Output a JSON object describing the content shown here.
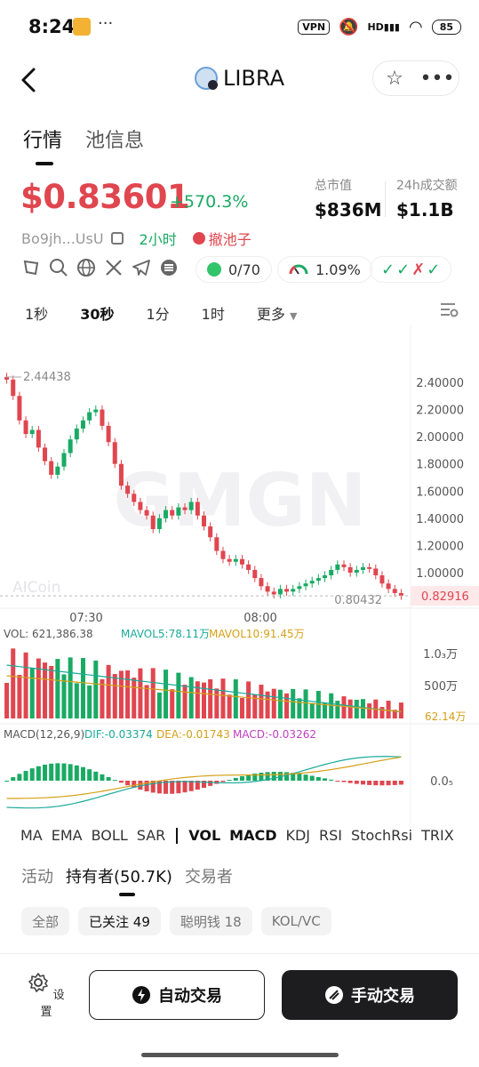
{
  "status": {
    "time": "8:24",
    "vpn": "VPN",
    "hd": "HD",
    "battery": "85"
  },
  "header": {
    "title": "LIBRA"
  },
  "top_tabs": [
    {
      "label": "行情"
    },
    {
      "label": "池信息"
    }
  ],
  "price": {
    "value": "$0.83601",
    "change": "+570.3%"
  },
  "stats": [
    {
      "label": "总市值",
      "value": "$836M"
    },
    {
      "label": "24h成交额",
      "value": "$1.1B"
    }
  ],
  "meta": {
    "address": "Bo9jh...UsU",
    "age": "2小时",
    "pool": "撤池子"
  },
  "chips": {
    "holders_ratio": "0/70",
    "percent": "1.09%"
  },
  "timeframes": [
    "1秒",
    "30秒",
    "1分",
    "1时",
    "更多"
  ],
  "chart_data": {
    "type": "candlestick",
    "price_axis": {
      "ticks": [
        "2.40000",
        "2.20000",
        "2.00000",
        "1.80000",
        "1.60000",
        "1.40000",
        "1.20000",
        "1.00000"
      ],
      "high_label": "2.44438",
      "low_label": "0.80432",
      "current_label": "0.82916"
    },
    "time_ticks": [
      "07:30",
      "08:00"
    ],
    "watermark": "GMGN",
    "source_watermark": "AICoin",
    "close_series": [
      2.42,
      2.3,
      2.12,
      2.02,
      2.05,
      1.92,
      1.82,
      1.72,
      1.78,
      1.88,
      1.98,
      2.06,
      2.12,
      2.18,
      2.2,
      2.08,
      1.96,
      1.8,
      1.64,
      1.58,
      1.52,
      1.46,
      1.42,
      1.32,
      1.4,
      1.46,
      1.42,
      1.48,
      1.46,
      1.52,
      1.42,
      1.34,
      1.26,
      1.16,
      1.1,
      1.08,
      1.1,
      1.06,
      1.02,
      0.96,
      0.9,
      0.86,
      0.84,
      0.88,
      0.86,
      0.88,
      0.9,
      0.92,
      0.94,
      0.96,
      0.98,
      1.02,
      1.06,
      1.04,
      1.0,
      1.02,
      1.04,
      1.03,
      0.98,
      0.92,
      0.88,
      0.85,
      0.83
    ]
  },
  "volume": {
    "label": "VOL: 621,386.38",
    "ma5": "MAVOL5:78.11万",
    "ma10": "MAVOL10:91.45万",
    "ticks": [
      "1.0₃万",
      "500万"
    ],
    "current": "62.14万"
  },
  "macd": {
    "label": "MACD(12,26,9)",
    "dif": "DIF:-0.03374",
    "dea": "DEA:-0.01743",
    "macd": "MACD:-0.03262",
    "tick": "0.0₅"
  },
  "indicators": [
    "MA",
    "EMA",
    "BOLL",
    "SAR",
    "VOL",
    "MACD",
    "KDJ",
    "RSI",
    "StochRsi",
    "TRIX"
  ],
  "lower_tabs": [
    "活动",
    "持有者(50.7K)",
    "交易者"
  ],
  "filters": [
    "全部",
    "已关注 49",
    "聪明钱 18",
    "KOL/VC"
  ],
  "bottom": {
    "settings": "设置",
    "auto": "自动交易",
    "manual": "手动交易"
  },
  "colors": {
    "up": "#1aaa64",
    "down": "#e0464f"
  }
}
